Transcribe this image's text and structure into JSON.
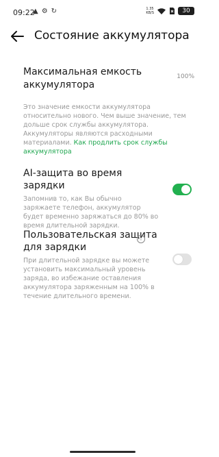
{
  "status_bar": {
    "time": "09:22",
    "left_icons": [
      "alert-icon",
      "notification-icon",
      "sync-icon"
    ],
    "network_speed": "1.35",
    "network_unit": "KB/S",
    "battery": "30"
  },
  "header": {
    "title": "Состояние аккумулятора"
  },
  "capacity": {
    "label": "Максимальная емкость аккумулятора",
    "value": "100%"
  },
  "info": {
    "text": "Это значение емкости аккумулятора относительно нового. Чем выше значение, тем дольше срок службы аккумулятора. Аккумуляторы являются расходными материалами. ",
    "link": "Как продлить срок службы аккумулятора"
  },
  "ai_protection": {
    "title": "AI-защита во время зарядки",
    "description": "Запомнив то, как Вы обычно заряжаете телефон, аккумулятор будет временно заряжаться до 80% во время длительной зарядки.",
    "enabled": true
  },
  "custom_protection": {
    "title": "Пользовательская защита для зарядки",
    "description": "При длительной зарядке вы можете установить максимальный уровень заряда, во избежание оставления аккумулятора заряженным на 100% в течение длительного времени.",
    "enabled": false
  },
  "colors": {
    "accent": "#22b04f",
    "link": "#1fa64f",
    "secondary_text": "#9a9a9a"
  }
}
